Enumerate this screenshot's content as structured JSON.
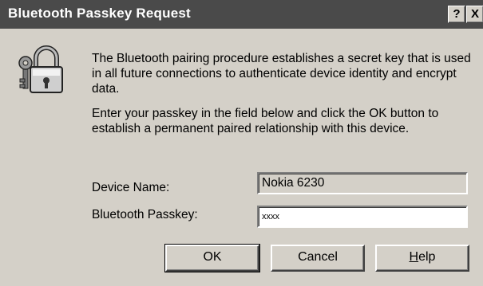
{
  "window": {
    "title": "Bluetooth Passkey Request",
    "help_glyph": "?",
    "close_glyph": "X"
  },
  "icons": {
    "main": "padlock-keys-icon"
  },
  "body": {
    "paragraph1": "The Bluetooth pairing procedure establishes a secret key that is used in all future connections to authenticate device identity and encrypt data.",
    "paragraph2": "Enter your passkey in the field below and click the OK button to establish a permanent paired relationship with this device."
  },
  "form": {
    "device_name_label": "Device Name:",
    "device_name_value": "Nokia 6230",
    "passkey_label": "Bluetooth Passkey:",
    "passkey_value": "xxxx"
  },
  "buttons": {
    "ok": "OK",
    "cancel": "Cancel",
    "help_prefix": "H",
    "help_rest": "elp"
  }
}
